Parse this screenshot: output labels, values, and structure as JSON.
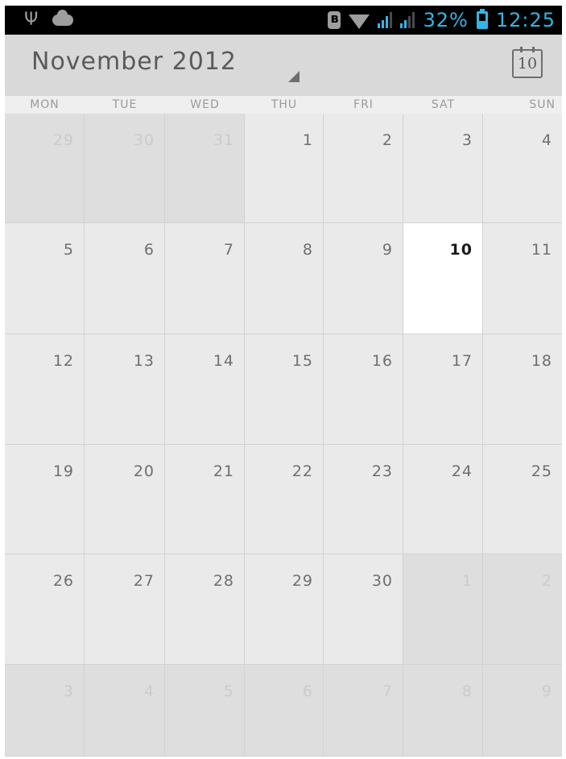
{
  "status_bar": {
    "icons": [
      "usb-icon",
      "cloud-icon",
      "bluetooth-icon",
      "wifi-icon",
      "signal-icon",
      "signal-icon",
      "battery-icon"
    ],
    "battery": "32%",
    "time": "12:25",
    "accent_color": "#33b5e5"
  },
  "action_bar": {
    "title": "November 2012",
    "today_button": "10"
  },
  "calendar": {
    "weekdays": [
      "MON",
      "TUE",
      "WED",
      "THU",
      "FRI",
      "SAT",
      "SUN"
    ],
    "weeks": [
      [
        {
          "day": "29",
          "other": true
        },
        {
          "day": "30",
          "other": true
        },
        {
          "day": "31",
          "other": true
        },
        {
          "day": "1"
        },
        {
          "day": "2"
        },
        {
          "day": "3"
        },
        {
          "day": "4"
        }
      ],
      [
        {
          "day": "5"
        },
        {
          "day": "6"
        },
        {
          "day": "7"
        },
        {
          "day": "8"
        },
        {
          "day": "9"
        },
        {
          "day": "10",
          "today": true
        },
        {
          "day": "11"
        }
      ],
      [
        {
          "day": "12"
        },
        {
          "day": "13"
        },
        {
          "day": "14"
        },
        {
          "day": "15"
        },
        {
          "day": "16"
        },
        {
          "day": "17"
        },
        {
          "day": "18"
        }
      ],
      [
        {
          "day": "19"
        },
        {
          "day": "20"
        },
        {
          "day": "21"
        },
        {
          "day": "22"
        },
        {
          "day": "23"
        },
        {
          "day": "24"
        },
        {
          "day": "25"
        }
      ],
      [
        {
          "day": "26"
        },
        {
          "day": "27"
        },
        {
          "day": "28"
        },
        {
          "day": "29"
        },
        {
          "day": "30"
        },
        {
          "day": "1",
          "other": true
        },
        {
          "day": "2",
          "other": true
        }
      ],
      [
        {
          "day": "3",
          "other": true
        },
        {
          "day": "4",
          "other": true
        },
        {
          "day": "5",
          "other": true
        },
        {
          "day": "6",
          "other": true
        },
        {
          "day": "7",
          "other": true
        },
        {
          "day": "8",
          "other": true
        },
        {
          "day": "9",
          "other": true
        }
      ]
    ]
  }
}
